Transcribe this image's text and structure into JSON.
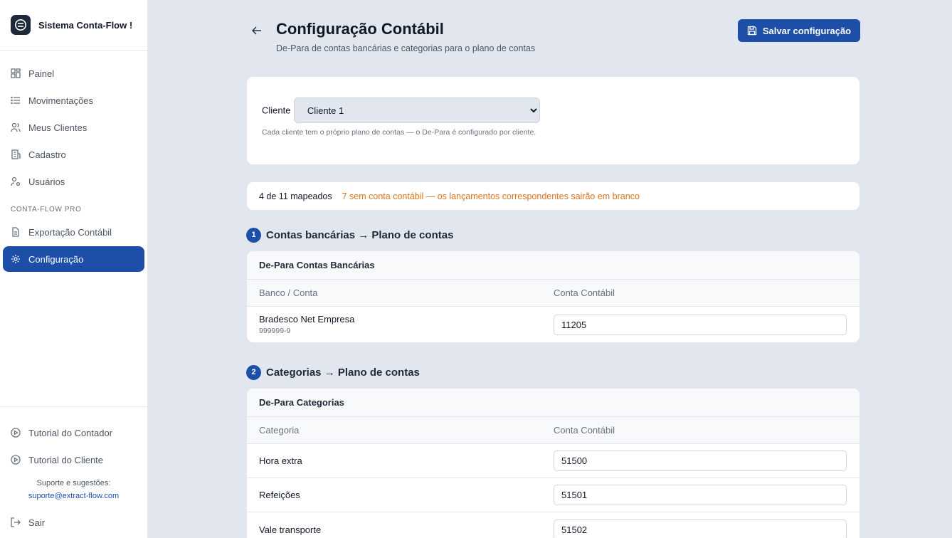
{
  "app": {
    "name": "Sistema Conta-Flow !"
  },
  "sidebar": {
    "items": [
      {
        "label": "Painel",
        "icon": "dashboard-icon"
      },
      {
        "label": "Movimentações",
        "icon": "list-icon"
      },
      {
        "label": "Meus Clientes",
        "icon": "users-icon"
      },
      {
        "label": "Cadastro",
        "icon": "building-icon"
      },
      {
        "label": "Usuários",
        "icon": "user-key-icon"
      }
    ],
    "section_label": "CONTA-FLOW PRO",
    "pro_items": [
      {
        "label": "Exportação Contábil",
        "icon": "file-icon"
      },
      {
        "label": "Configuração",
        "icon": "gear-icon",
        "active": true
      }
    ],
    "bottom_items": [
      {
        "label": "Tutorial do Contador",
        "icon": "play-circle-icon"
      },
      {
        "label": "Tutorial do Cliente",
        "icon": "play-circle-icon"
      }
    ],
    "support_label": "Suporte e sugestões:",
    "support_email": "suporte@extract-flow.com",
    "logout_label": "Sair"
  },
  "header": {
    "title": "Configuração Contábil",
    "subtitle": "De-Para de contas bancárias e categorias para o plano de contas",
    "save_label": "Salvar configuração"
  },
  "client": {
    "label": "Cliente",
    "selected": "Cliente 1",
    "help": "Cada cliente tem o próprio plano de contas — o De-Para é configurado por cliente."
  },
  "status": {
    "count": "4 de 11 mapeados",
    "warning": "7 sem conta contábil — os lançamentos correspondentes sairão em branco"
  },
  "bank_section": {
    "step": "1",
    "title": "Contas bancárias → Plano de contas",
    "table_title": "De-Para Contas Bancárias",
    "col_a": "Banco / Conta",
    "col_b": "Conta Contábil",
    "rows": [
      {
        "name": "Bradesco Net Empresa",
        "sub": "999999-9",
        "account": "11205"
      }
    ]
  },
  "category_section": {
    "step": "2",
    "title": "Categorias → Plano de contas",
    "table_title": "De-Para Categorias",
    "col_a": "Categoria",
    "col_b": "Conta Contábil",
    "rows": [
      {
        "name": "Hora extra",
        "account": "51500"
      },
      {
        "name": "Refeições",
        "account": "51501"
      },
      {
        "name": "Vale transporte",
        "account": "51502"
      }
    ]
  },
  "colors": {
    "accent": "#1e4fa8",
    "warning": "#d9741c",
    "background": "#e2e6ee"
  }
}
